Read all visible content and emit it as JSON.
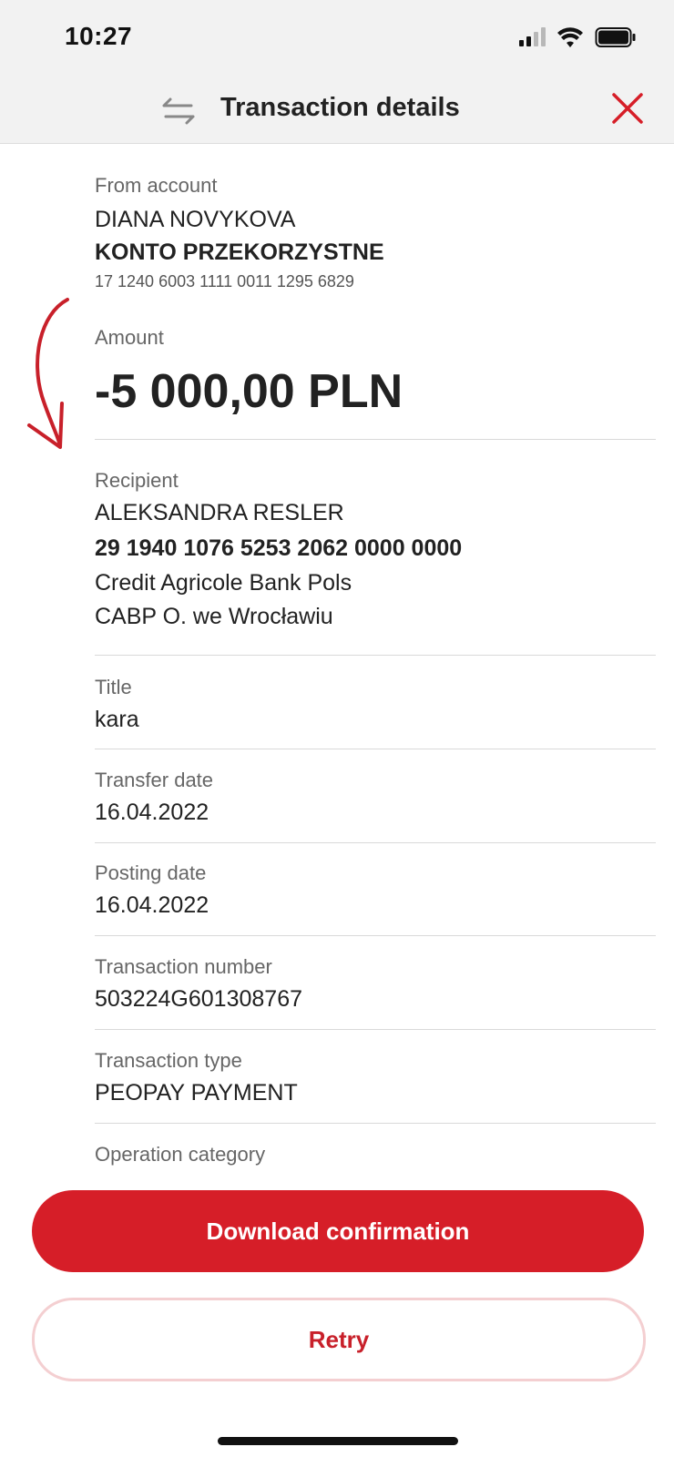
{
  "status_bar": {
    "time": "10:27"
  },
  "header": {
    "title": "Transaction details"
  },
  "from_account": {
    "label": "From account",
    "name": "DIANA NOVYKOVA",
    "account_type": "KONTO PRZEKORZYSTNE",
    "number": "17 1240 6003 1111 0011 1295 6829"
  },
  "amount": {
    "label": "Amount",
    "value": "-5 000,00 PLN"
  },
  "recipient": {
    "label": "Recipient",
    "name": "ALEKSANDRA RESLER",
    "account_number": "29 1940 1076 5253 2062 0000 0000",
    "bank_line1": "Credit Agricole Bank Pols",
    "bank_line2": "CABP  O. we Wrocławiu"
  },
  "title_field": {
    "label": "Title",
    "value": "kara"
  },
  "transfer_date": {
    "label": "Transfer date",
    "value": "16.04.2022"
  },
  "posting_date": {
    "label": "Posting date",
    "value": "16.04.2022"
  },
  "transaction_number": {
    "label": "Transaction number",
    "value": "503224G601308767"
  },
  "transaction_type": {
    "label": "Transaction type",
    "value": "PEOPAY PAYMENT"
  },
  "operation_category": {
    "label": "Operation category"
  },
  "buttons": {
    "download": "Download confirmation",
    "retry": "Retry"
  },
  "colors": {
    "accent": "#d61e28",
    "retry_border": "#f4cfd1",
    "header_bg": "#f2f2f2"
  }
}
